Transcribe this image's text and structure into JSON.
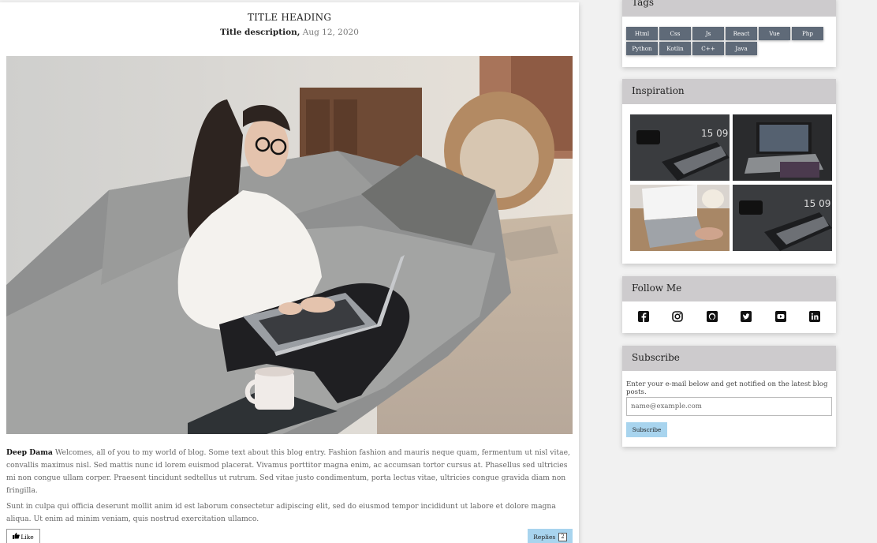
{
  "post": {
    "title": "TITLE HEADING",
    "description": "Title description,",
    "date": "Aug 12, 2020",
    "author": "Deep Dama",
    "paragraph1": "Welcomes, all of you to my world of blog. Some text about this blog entry. Fashion fashion and mauris neque quam, fermentum ut nisl vitae, convallis maximus nisl. Sed mattis nunc id lorem euismod placerat. Vivamus porttitor magna enim, ac accumsan tortor cursus at. Phasellus sed ultricies mi non congue ullam corper. Praesent tincidunt sedtellus ut rutrum. Sed vitae justo condimentum, porta lectus vitae, ultricies congue gravida diam non fringilla.",
    "paragraph2": "Sunt in culpa qui officia deserunt mollit anim id est laborum consectetur adipiscing elit, sed do eiusmod tempor incididunt ut labore et dolore magna aliqua. Ut enim ad minim veniam, quis nostrud exercitation ullamco.",
    "like_label": "Like",
    "replies_label": "Replies",
    "replies_count": "2"
  },
  "sidebar": {
    "tags_title": "Tags",
    "tags": [
      "Html",
      "Css",
      "Js",
      "React",
      "Vue",
      "Php",
      "Python",
      "Kotlin",
      "C++",
      "Java"
    ],
    "inspiration_title": "Inspiration",
    "follow_title": "Follow Me",
    "social_icons": [
      "facebook-icon",
      "instagram-icon",
      "github-icon",
      "twitter-icon",
      "youtube-icon",
      "linkedin-icon"
    ],
    "subscribe_title": "Subscribe",
    "subscribe_text": "Enter your e-mail below and get notified on the latest blog posts.",
    "subscribe_placeholder": "name@example.com",
    "subscribe_button": "Subscribe"
  },
  "colors": {
    "tag_bg": "#5f6a78",
    "button_bg": "#a8d4ee",
    "header_bg": "#cdcbcd"
  }
}
